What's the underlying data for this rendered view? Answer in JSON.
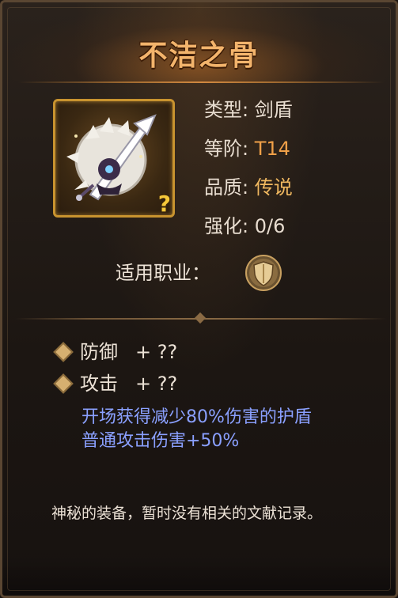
{
  "item": {
    "name": "不洁之骨",
    "type_label": "类型: ",
    "type_value": "剑盾",
    "tier_label": "等阶: ",
    "tier_value": "T14",
    "quality_label": "品质: ",
    "quality_value": "传说",
    "enhance_label": "强化: ",
    "enhance_value": "0/6",
    "unknown_mark": "?",
    "icon": "bone-shield-sword-icon"
  },
  "job": {
    "label": "适用职业：",
    "icon": "shield-class-icon"
  },
  "attributes": [
    {
      "name": "防御",
      "value": "+ ??"
    },
    {
      "name": "攻击",
      "value": "+ ??"
    }
  ],
  "skills": [
    "开场获得减少80%伤害的护盾",
    "普通攻击伤害+50%"
  ],
  "description": "神秘的装备，暂时没有相关的文献记录。",
  "colors": {
    "title": "#f3b46c",
    "tier": "#f0a048",
    "quality": "#f0b860",
    "skill": "#8aa0ff",
    "frame": "#c8932f"
  }
}
